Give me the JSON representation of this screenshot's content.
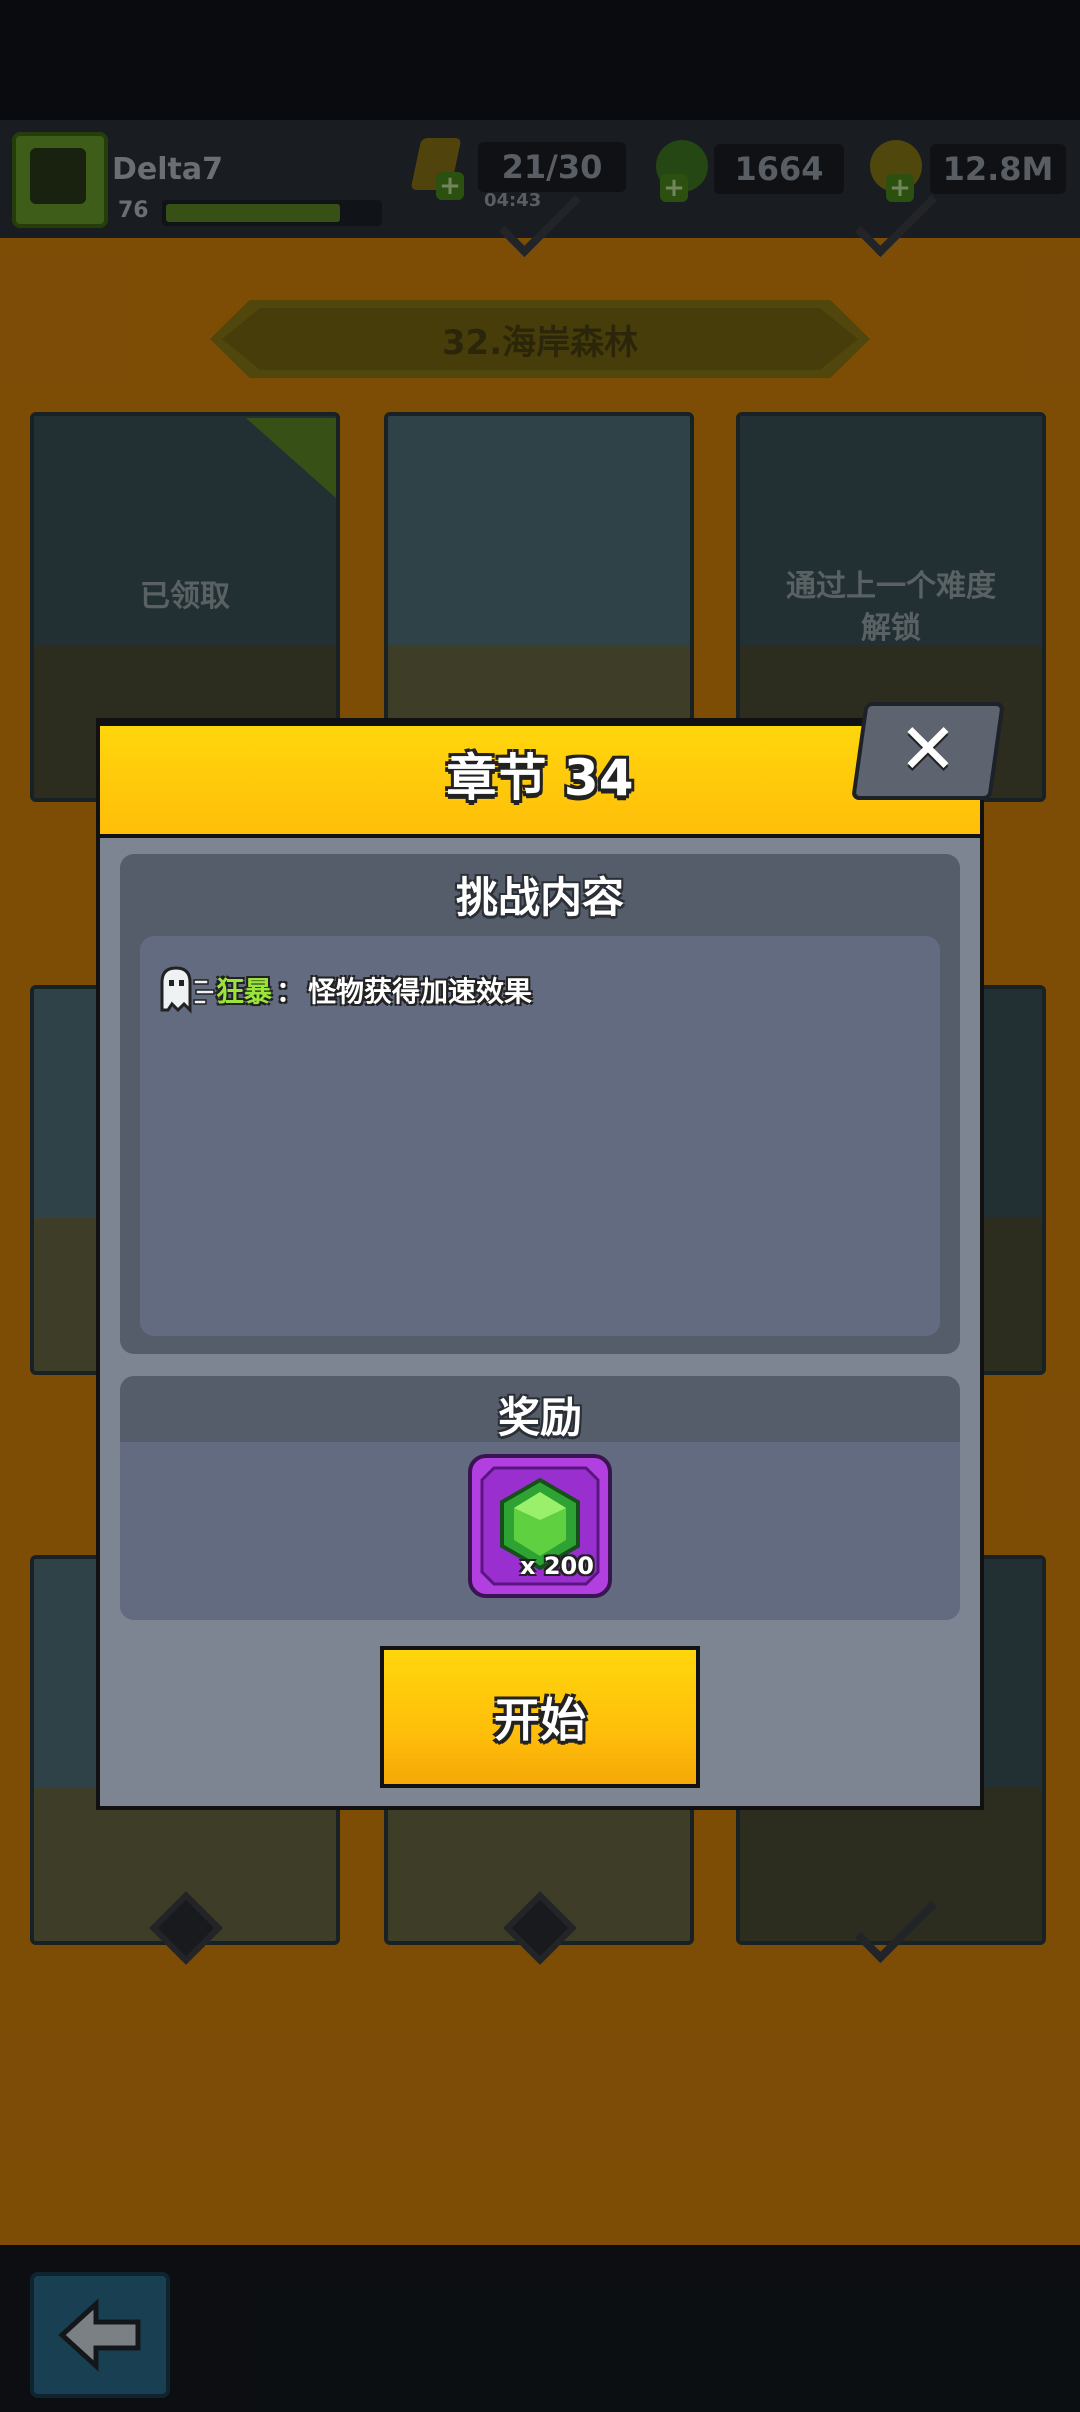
{
  "player": {
    "name": "Delta7",
    "level": "76",
    "xp_fraction": 0.82
  },
  "resources": {
    "energy": "21/30",
    "energy_timer": "04:43",
    "gems": "1664",
    "coins": "12.8M"
  },
  "stage": {
    "banner": "32.海岸森林"
  },
  "difficulty_cards": [
    {
      "label": "已领取"
    },
    {
      "label": ""
    },
    {
      "label": "通过上一个难度\n解锁"
    }
  ],
  "dialog": {
    "title": "章节 34",
    "challenge_header": "挑战内容",
    "modifier": {
      "name": "狂暴",
      "separator": "：",
      "description": "怪物获得加速效果"
    },
    "reward_header": "奖励",
    "reward": {
      "item": "gem",
      "quantity": "x 200"
    },
    "start_label": "开始"
  },
  "colors": {
    "accent_yellow": "#ffd60c",
    "reward_purple": "#b23fe0",
    "modifier_green": "#9be43b"
  }
}
